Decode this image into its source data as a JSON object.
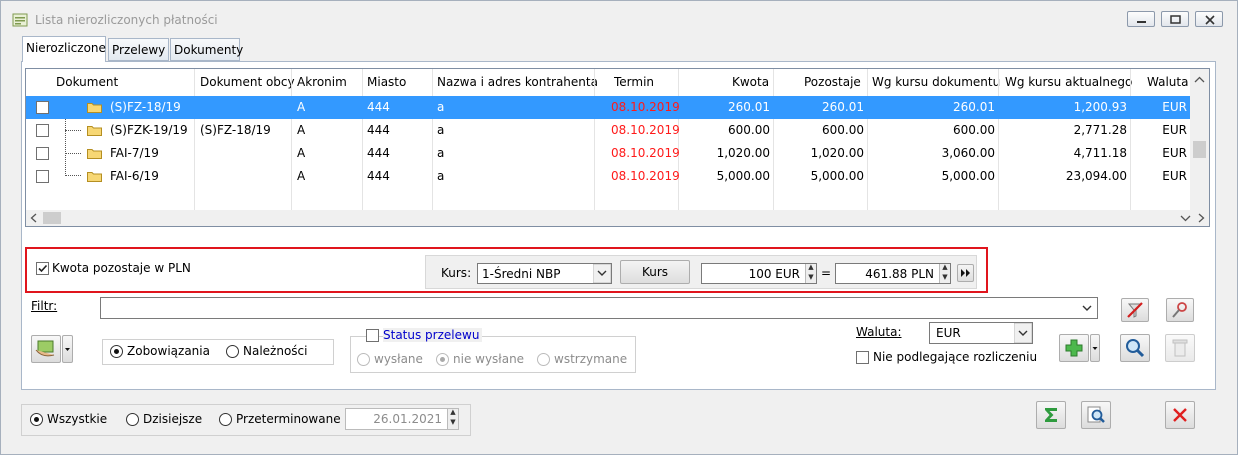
{
  "window": {
    "title": "Lista nierozliczonych płatności"
  },
  "tabs": [
    {
      "label": "Nierozliczone"
    },
    {
      "label": "Przelewy"
    },
    {
      "label": "Dokumenty"
    }
  ],
  "grid": {
    "columns": [
      "Dokument",
      "Dokument obcy",
      "Akronim",
      "Miasto",
      "Nazwa i adres kontrahenta",
      "Termin",
      "Kwota",
      "Pozostaje",
      "Wg kursu dokumentu",
      "Wg kursu aktualnego",
      "Waluta"
    ],
    "rows": [
      {
        "doc": "(S)FZ-18/19",
        "obcy": "",
        "akronim": "A",
        "miasto": "444",
        "nazwa": "a",
        "termin": "08.10.2019",
        "kwota": "260.01",
        "pozostaje": "260.01",
        "wg_dok": "260.01",
        "wg_akt": "1,200.93",
        "waluta": "EUR",
        "selected": true
      },
      {
        "doc": "(S)FZK-19/19",
        "obcy": "(S)FZ-18/19",
        "akronim": "A",
        "miasto": "444",
        "nazwa": "a",
        "termin": "08.10.2019",
        "kwota": "600.00",
        "pozostaje": "600.00",
        "wg_dok": "600.00",
        "wg_akt": "2,771.28",
        "waluta": "EUR",
        "selected": false
      },
      {
        "doc": "FAI-7/19",
        "obcy": "",
        "akronim": "A",
        "miasto": "444",
        "nazwa": "a",
        "termin": "08.10.2019",
        "kwota": "1,020.00",
        "pozostaje": "1,020.00",
        "wg_dok": "3,060.00",
        "wg_akt": "4,711.18",
        "waluta": "EUR",
        "selected": false
      },
      {
        "doc": "FAI-6/19",
        "obcy": "",
        "akronim": "A",
        "miasto": "444",
        "nazwa": "a",
        "termin": "08.10.2019",
        "kwota": "5,000.00",
        "pozostaje": "5,000.00",
        "wg_dok": "5,000.00",
        "wg_akt": "23,094.00",
        "waluta": "EUR",
        "selected": false
      }
    ]
  },
  "pln": {
    "checkbox_label": "Kwota pozostaje w PLN",
    "checked": true,
    "kurs_label": "Kurs:",
    "kurs_value": "1-Średni NBP",
    "kurs_button": "Kurs",
    "amount_eur": "100 EUR",
    "equals": "=",
    "amount_pln": "461.88 PLN"
  },
  "filter": {
    "label": "Filtr:",
    "value": ""
  },
  "type": {
    "zobowiazania": "Zobowiązania",
    "naleznosci": "Należności",
    "selected": "zobowiazania"
  },
  "status": {
    "label": "Status przelewu",
    "wyslane": "wysłane",
    "nie_wyslane": "nie wysłane",
    "wstrzymane": "wstrzymane"
  },
  "currency": {
    "label": "Waluta:",
    "value": "EUR",
    "nie_podlegajace": "Nie podlegające rozliczeniu"
  },
  "period": {
    "wszystkie": "Wszystkie",
    "dzisiejsze": "Dzisiejsze",
    "przeterminowane": "Przeterminowane",
    "date": "26.01.2021",
    "selected": "wszystkie"
  },
  "icons": {
    "title": "app-icon",
    "sigma": "sigma-icon",
    "preview": "preview-icon",
    "close": "close-x-icon",
    "add": "plus-icon",
    "search": "magnifier-icon",
    "delete": "trash-icon",
    "clear_filter": "clear-filter-icon",
    "filter_edit": "filter-construct-icon",
    "payment": "payment-icon"
  },
  "colors": {
    "selection": "#3399ff",
    "overdue": "#ff1a1a",
    "highlight_box": "#e0151d",
    "status_label": "#0000cc"
  }
}
